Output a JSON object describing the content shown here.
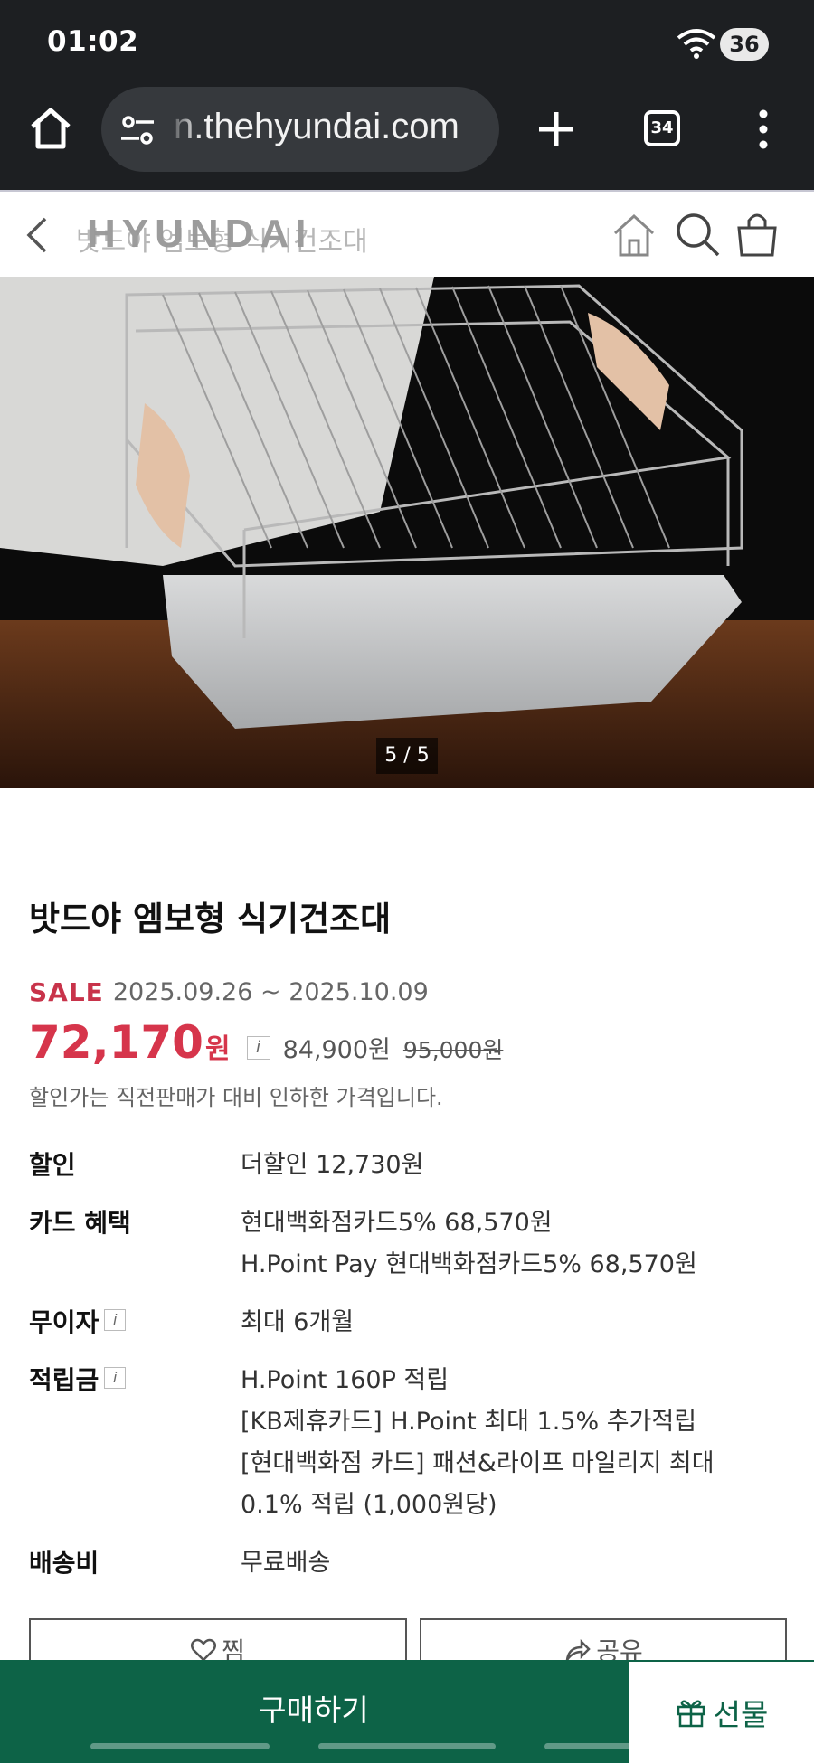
{
  "status_bar": {
    "time": "01:02",
    "battery": "36"
  },
  "browser": {
    "url": "n.thehyundai.com",
    "tab_count": "34"
  },
  "site_header": {
    "logo": "HYUNDAI",
    "faded_title": "밧드야 엠보형 식기건조대"
  },
  "hero": {
    "counter": "5 / 5"
  },
  "product": {
    "title": "밧드야 엠보형 식기건조대",
    "sale_label": "SALE",
    "sale_period": "2025.09.26 ~ 2025.10.09",
    "price": "72,170",
    "price_unit": "원",
    "info_icon": "i",
    "original_price": "84,900원",
    "list_price": "95,000원",
    "price_note": "할인가는 직전판매가 대비 인하한 가격입니다."
  },
  "info": {
    "discount_label": "할인",
    "discount_value": "더할인 12,730원",
    "card_label": "카드 혜택",
    "card_values": [
      "현대백화점카드5% 68,570원",
      "H.Point Pay 현대백화점카드5% 68,570원"
    ],
    "interest_label": "무이자",
    "interest_value": "최대 6개월",
    "points_label": "적립금",
    "points_values": [
      "H.Point 160P 적립",
      "[KB제휴카드] H.Point 최대 1.5% 추가적립",
      "[현대백화점 카드] 패션&라이프 마일리지 최대",
      "0.1% 적립 (1,000원당)"
    ],
    "shipping_label": "배송비",
    "shipping_value": "무료배송"
  },
  "buttons": {
    "like": "찜",
    "share": "공유",
    "buy": "구매하기",
    "gift": "선물"
  },
  "colors": {
    "brand_green": "#0d6347",
    "sale_red": "#d6354b",
    "status_bg": "#1d1f22"
  },
  "icons": [
    "wifi-icon",
    "home-icon",
    "tune-icon",
    "plus-icon",
    "tabs-icon",
    "more-icon",
    "back-icon",
    "search-icon",
    "bag-icon",
    "heart-icon",
    "share-icon",
    "gift-icon"
  ]
}
